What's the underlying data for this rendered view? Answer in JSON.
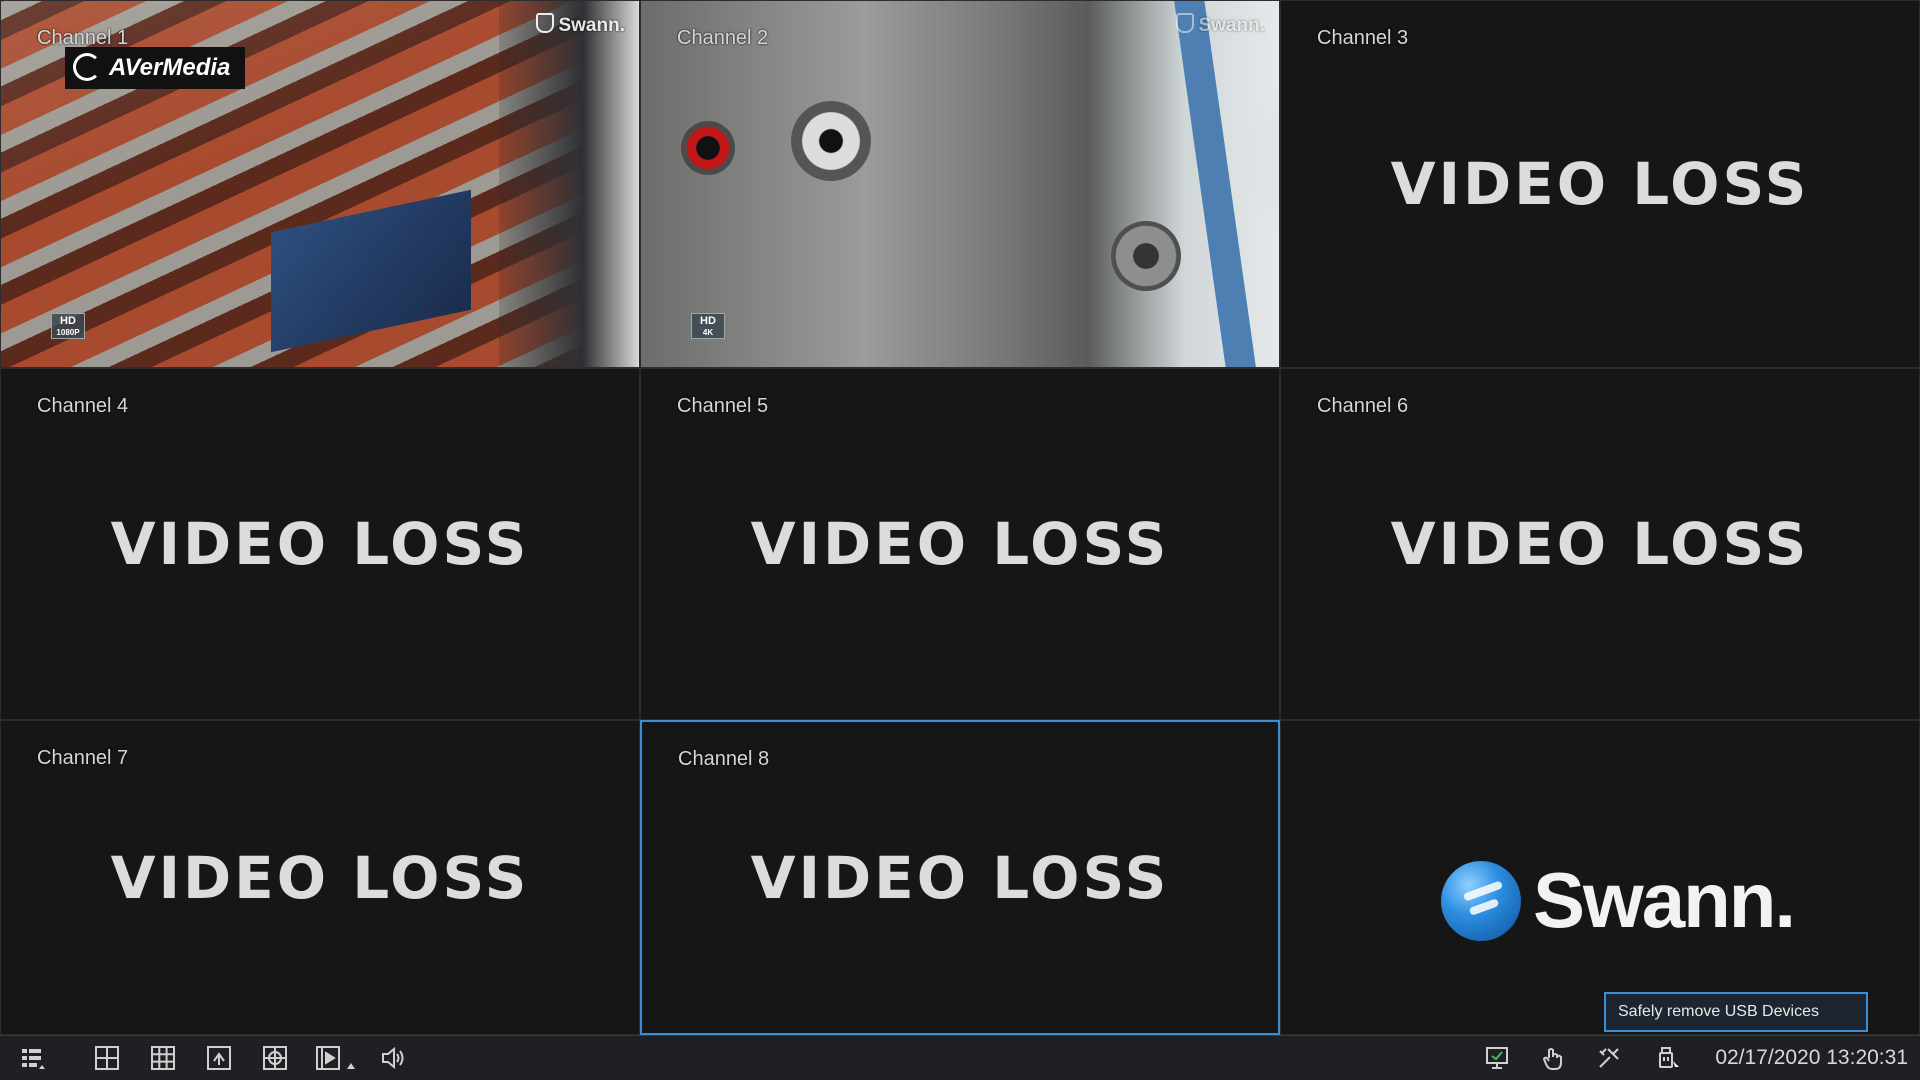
{
  "channels": [
    {
      "label": "Channel 1",
      "status": "",
      "hd_badge": "HD",
      "hd_res": "1080P",
      "watermark": "Swann."
    },
    {
      "label": "Channel 2",
      "status": "",
      "hd_badge": "HD",
      "hd_res": "4K",
      "watermark": "Swann."
    },
    {
      "label": "Channel 3",
      "status": "VIDEO LOSS"
    },
    {
      "label": "Channel 4",
      "status": "VIDEO LOSS"
    },
    {
      "label": "Channel 5",
      "status": "VIDEO LOSS"
    },
    {
      "label": "Channel 6",
      "status": "VIDEO LOSS"
    },
    {
      "label": "Channel 7",
      "status": "VIDEO LOSS"
    },
    {
      "label": "Channel 8",
      "status": "VIDEO LOSS"
    }
  ],
  "overlay_logo": "AVerMedia",
  "brand_logo": "Swann.",
  "tooltip": "Safely remove USB Devices",
  "taskbar": {
    "left_icons": [
      "menu-icon",
      "layout-4-icon",
      "layout-9-icon",
      "single-view-icon",
      "sequence-icon",
      "playback-icon",
      "volume-icon"
    ],
    "right_icons": [
      "monitor-icon",
      "manual-record-icon",
      "tools-icon",
      "usb-icon"
    ],
    "datetime": "02/17/2020 13:20:31"
  },
  "colors": {
    "selection": "#3b8fd6",
    "background": "#161617",
    "taskbar": "#1e2023"
  }
}
